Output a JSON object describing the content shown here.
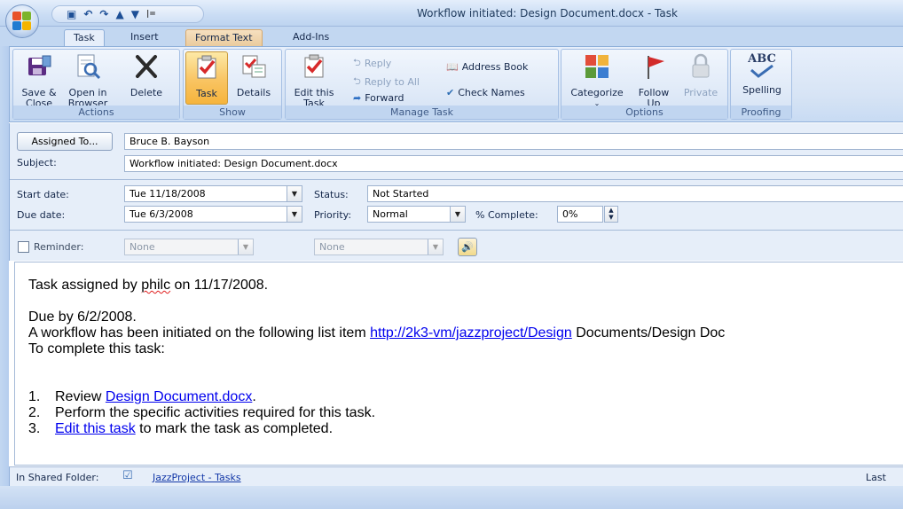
{
  "window": {
    "title": "Workflow initiated:  Design Document.docx - Task",
    "qat_icons": [
      "save-icon",
      "undo-icon",
      "redo-icon",
      "previous-icon",
      "next-icon",
      "customize-qat-icon"
    ]
  },
  "tabs": [
    {
      "label": "Task"
    },
    {
      "label": "Insert"
    },
    {
      "label": "Format Text"
    },
    {
      "label": "Add-Ins"
    }
  ],
  "ribbon": {
    "actions": {
      "label": "Actions",
      "save_close": "Save &\nClose",
      "open_browser": "Open in\nBrowser",
      "delete": "Delete"
    },
    "show": {
      "label": "Show",
      "task": "Task",
      "details": "Details"
    },
    "manage": {
      "label": "Manage Task",
      "edit_task": "Edit this\nTask",
      "reply": "Reply",
      "reply_all": "Reply to All",
      "forward": "Forward",
      "address_book": "Address Book",
      "check_names": "Check Names"
    },
    "options": {
      "label": "Options",
      "categorize": "Categorize",
      "follow_up": "Follow\nUp",
      "private": "Private"
    },
    "proofing": {
      "label": "Proofing",
      "spelling": "Spelling",
      "abc": "ABC"
    }
  },
  "form": {
    "assigned_to_button": "Assigned To...",
    "assigned_to_value": "Bruce B. Bayson",
    "subject_label": "Subject:",
    "subject_value": "Workflow initiated:  Design Document.docx",
    "start_date_label": "Start date:",
    "start_date_value": "Tue 11/18/2008",
    "due_date_label": "Due date:",
    "due_date_value": "Tue 6/3/2008",
    "status_label": "Status:",
    "status_value": "Not Started",
    "priority_label": "Priority:",
    "priority_value": "Normal",
    "percent_label": "% Complete:",
    "percent_value": "0%",
    "reminder_label": "Reminder:",
    "reminder_checked": false,
    "reminder_date": "None",
    "reminder_time": "None"
  },
  "body": {
    "line1_prefix": "Task assigned by ",
    "line1_user": "philc",
    "line1_suffix": " on 11/17/2008.",
    "due_line": "Due by 6/2/2008.",
    "workflow_prefix": "A workflow has been initiated on the following list item ",
    "workflow_link": "http://2k3-vm/jazzproject/Design",
    "workflow_suffix": " Documents/Design Doc",
    "complete_line": "To complete this task:",
    "steps": [
      {
        "num": "1.",
        "prefix": "Review ",
        "link": "Design Document.docx",
        "suffix": "."
      },
      {
        "num": "2.",
        "prefix": "Perform the specific activities required for this task.",
        "link": "",
        "suffix": ""
      },
      {
        "num": "3.",
        "prefix": "",
        "link": "Edit this task",
        "suffix": " to mark the task as completed."
      }
    ]
  },
  "statusbar": {
    "shared_folder_label": "In Shared Folder:",
    "folder_link": "JazzProject - Tasks",
    "right_text": "Last mo"
  }
}
